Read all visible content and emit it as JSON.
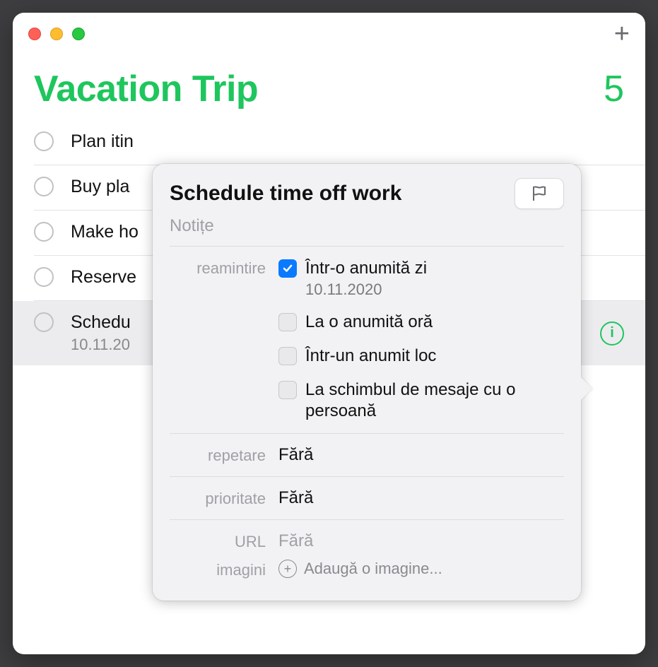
{
  "list": {
    "title": "Vacation Trip",
    "count": "5",
    "items": [
      {
        "title": "Plan itin",
        "date": ""
      },
      {
        "title": "Buy pla",
        "date": ""
      },
      {
        "title": "Make ho",
        "date": ""
      },
      {
        "title": "Reserve",
        "date": ""
      },
      {
        "title": "Schedu",
        "date": "10.11.20"
      }
    ]
  },
  "popover": {
    "title": "Schedule time off work",
    "notes_placeholder": "Notițe",
    "remind_label": "reamintire",
    "options": {
      "on_day": "Într-o anumită zi",
      "on_day_date": "10.11.2020",
      "at_time": "La o anumită oră",
      "at_location": "Într-un anumit loc",
      "on_message": "La schimbul de mesaje cu o persoană"
    },
    "repeat_label": "repetare",
    "repeat_value": "Fără",
    "priority_label": "prioritate",
    "priority_value": "Fără",
    "url_label": "URL",
    "url_placeholder": "Fără",
    "images_label": "imagini",
    "add_image_label": "Adaugă o imagine..."
  }
}
